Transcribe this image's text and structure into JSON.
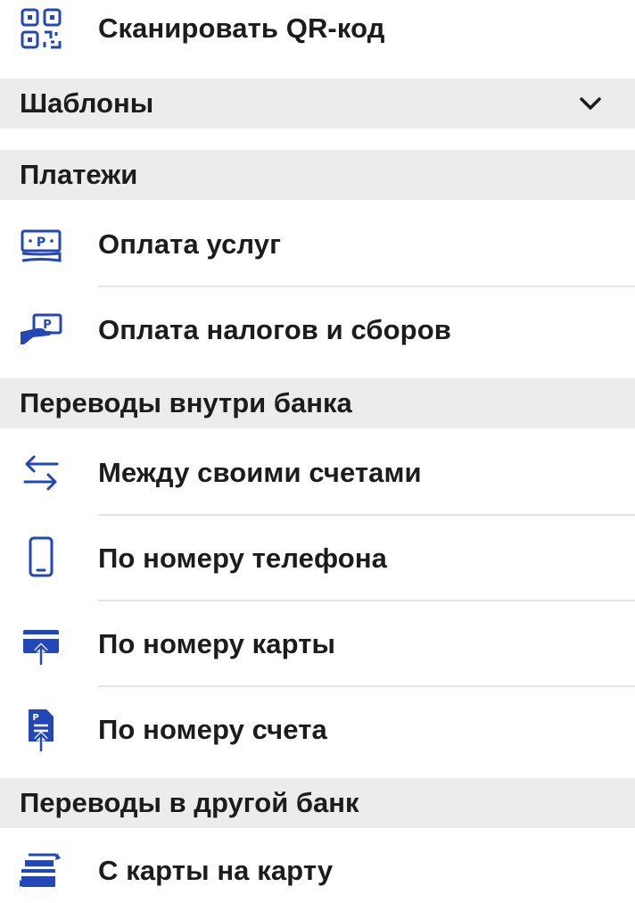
{
  "colors": {
    "accent": "#2347b8",
    "section_bg": "#ececec",
    "divider": "#e4e4e4",
    "text": "#1c1c1c"
  },
  "scan": {
    "label": "Сканировать QR-код",
    "icon": "qr-code-icon"
  },
  "templates": {
    "title": "Шаблоны",
    "icon": "chevron-down-icon"
  },
  "payments": {
    "title": "Платежи",
    "items": [
      {
        "label": "Оплата услуг",
        "icon": "bill-payment-icon"
      },
      {
        "label": "Оплата налогов и сборов",
        "icon": "tax-payment-icon"
      }
    ]
  },
  "internal": {
    "title": "Переводы внутри банка",
    "items": [
      {
        "label": "Между своими счетами",
        "icon": "transfer-arrows-icon"
      },
      {
        "label": "По номеру телефона",
        "icon": "phone-icon"
      },
      {
        "label": "По номеру карты",
        "icon": "card-transfer-icon"
      },
      {
        "label": "По номеру счета",
        "icon": "account-document-icon"
      }
    ]
  },
  "external": {
    "title": "Переводы в другой банк",
    "items": [
      {
        "label": "С карты на карту",
        "icon": "card-to-card-icon"
      }
    ]
  }
}
